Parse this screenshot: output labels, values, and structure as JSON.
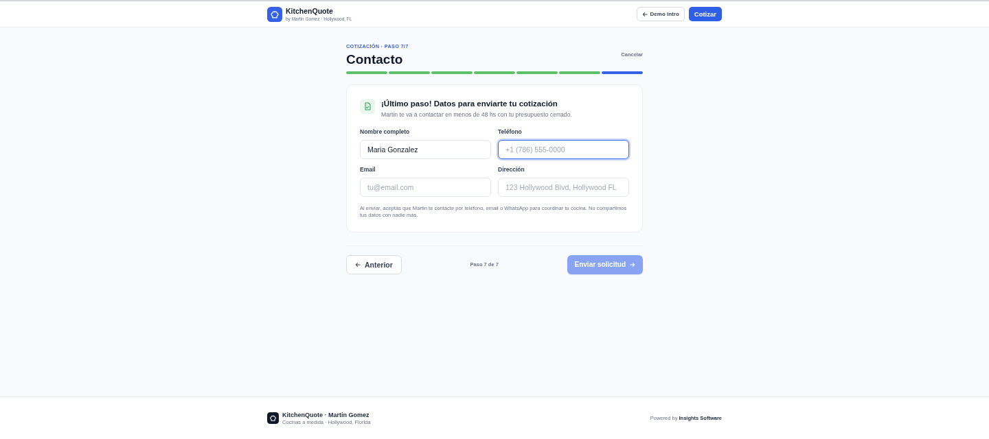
{
  "header": {
    "brand": "KitchenQuote",
    "tagline": "by Martin Gomez · Hollywood, FL",
    "buttons": [
      {
        "label": "Demo intro",
        "kind": "outline"
      },
      {
        "label": "Cotizar",
        "kind": "primary"
      }
    ]
  },
  "wizard": {
    "eyebrow": "COTIZACIÓN · PASO 7/7",
    "title": "Contacto",
    "cancel": "Cancelar",
    "steps": [
      {
        "done": true
      },
      {
        "done": true
      },
      {
        "done": true
      },
      {
        "done": true
      },
      {
        "done": true
      },
      {
        "done": true
      },
      {
        "done": false
      }
    ]
  },
  "card": {
    "title": "¡Último paso! Datos para enviarte tu cotización",
    "subtitle": "Martin te va a contactar en menos de 48 hs con tu presupuesto cerrado.",
    "fields": [
      {
        "label": "Nombre completo",
        "value": "Maria Gonzalez",
        "focused": false
      },
      {
        "label": "Teléfono",
        "placeholder": "+1 (786) 555-0000",
        "focused": true
      },
      {
        "label": "Email",
        "placeholder": "tu@email.com",
        "focused": false
      },
      {
        "label": "Dirección",
        "placeholder": "123 Hollywood Blvd, Hollywood FL",
        "focused": false
      }
    ],
    "consent": "Al enviar, aceptás que Martin te contacte por teléfono, email o WhatsApp para coordinar tu cocina. No compartimos tus datos con nadie más."
  },
  "nav": {
    "back": "Anterior",
    "progress": "Paso 7 de 7",
    "submit": {
      "label": "Enviar solicitud",
      "disabled": true
    }
  },
  "footer": {
    "brand": "KitchenQuote · Martin Gomez",
    "tagline": "Cocinas a medida · Hollywood, Florida",
    "powered": "Powered by **Insights Software**"
  }
}
